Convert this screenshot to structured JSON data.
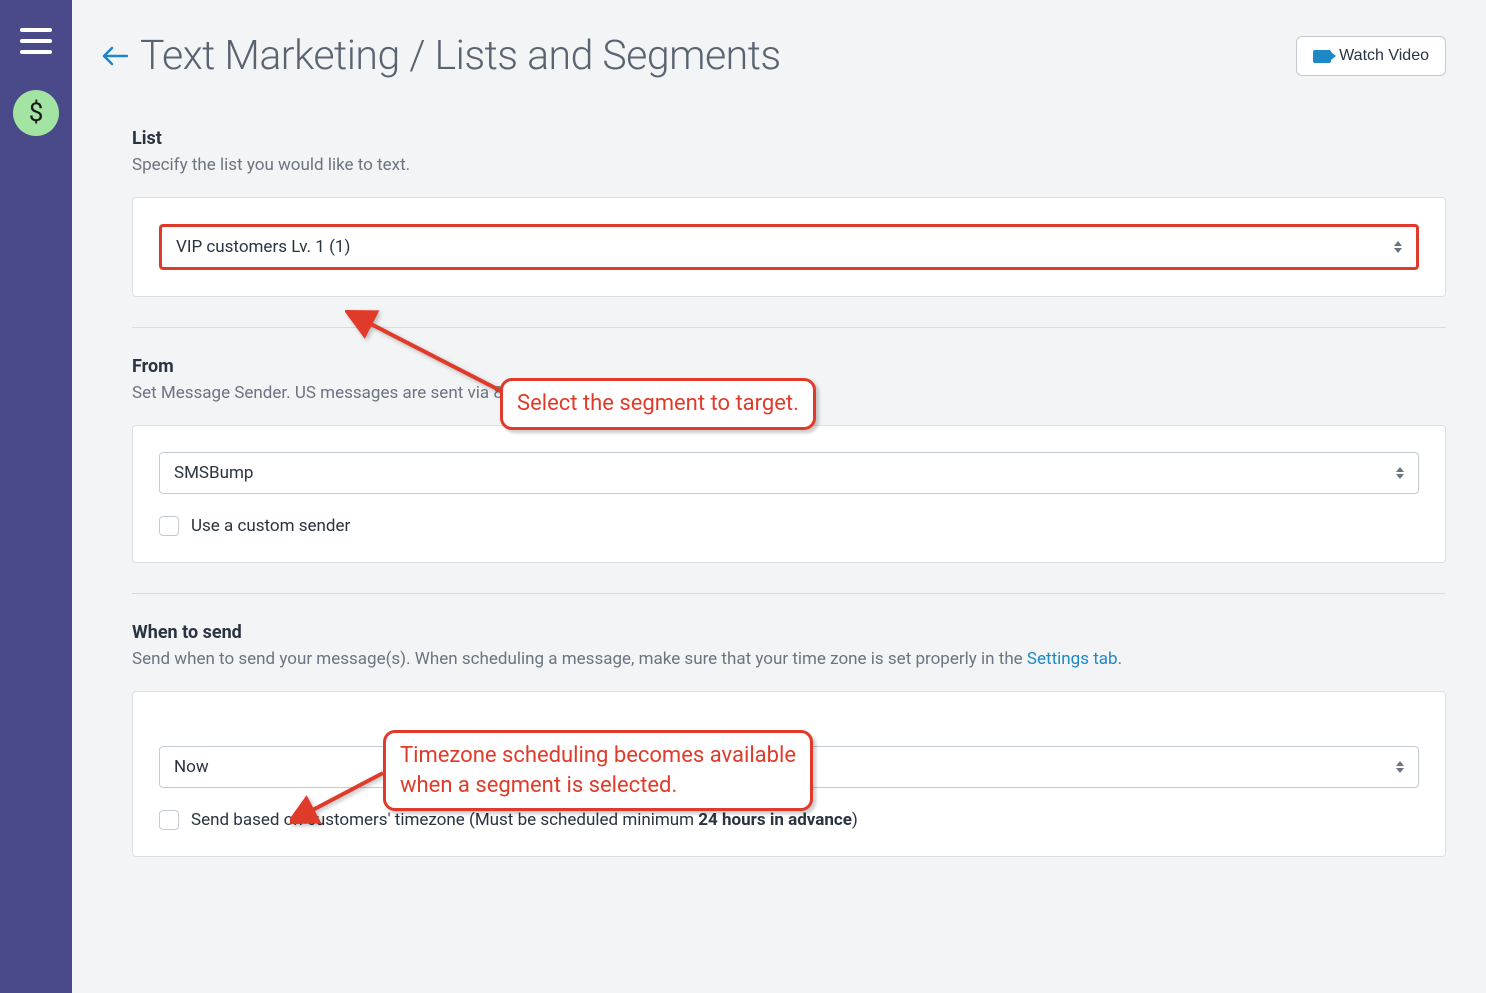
{
  "page": {
    "title": "Text Marketing / Lists and Segments",
    "watch_video_label": "Watch Video"
  },
  "sidebar": {
    "dollar_badge": "$"
  },
  "sections": {
    "list": {
      "label": "List",
      "desc": "Specify the list you would like to text.",
      "selected_value": "VIP customers Lv. 1 (1)"
    },
    "from": {
      "label": "From",
      "desc": "Set Message Sender. US messages are sent via 81787.",
      "selected_value": "SMSBump",
      "custom_sender_label": "Use a custom sender"
    },
    "when": {
      "label": "When to send",
      "desc_prefix": "Send when to send your message(s). When scheduling a message, make sure that your time zone is set properly in the ",
      "desc_link": "Settings tab",
      "desc_suffix": ".",
      "selected_value": "Now",
      "tz_label_prefix": "Send based on customers' timezone (Must be scheduled minimum ",
      "tz_label_bold": "24 hours in advance",
      "tz_label_suffix": ")"
    }
  },
  "callouts": {
    "select_segment": "Select the segment to target.",
    "timezone_line1": "Timezone scheduling becomes available",
    "timezone_line2": "when a segment is selected."
  }
}
